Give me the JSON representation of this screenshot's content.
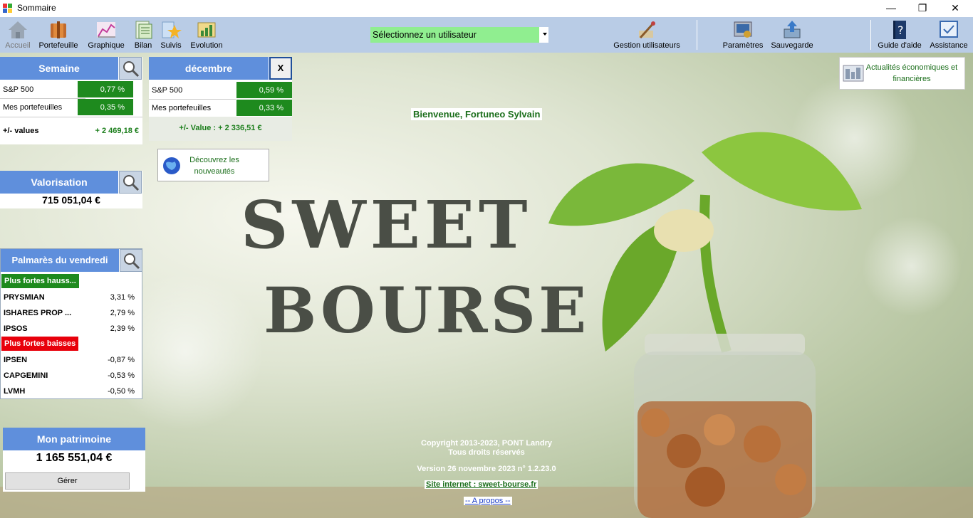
{
  "window": {
    "title": "Sommaire",
    "minimize": "—",
    "maximize": "❐",
    "close": "✕"
  },
  "toolbar": {
    "items": [
      {
        "label": "Accueil",
        "icon": "house-icon"
      },
      {
        "label": "Portefeuille",
        "icon": "portfolio-icon"
      },
      {
        "label": "Graphique",
        "icon": "chart-icon"
      },
      {
        "label": "Bilan",
        "icon": "report-icon"
      },
      {
        "label": "Suivis",
        "icon": "star-icon"
      },
      {
        "label": "Evolution",
        "icon": "evolution-icon"
      },
      {
        "label": "Gestion utilisateurs",
        "icon": "user-tools-icon"
      },
      {
        "label": "Paramètres",
        "icon": "settings-icon"
      },
      {
        "label": "Sauvegarde",
        "icon": "save-icon"
      },
      {
        "label": "Guide d'aide",
        "icon": "help-book-icon"
      },
      {
        "label": "Assistance",
        "icon": "assistance-icon"
      }
    ],
    "user_select": "Sélectionnez un utilisateur"
  },
  "semaine": {
    "title": "Semaine",
    "rows": [
      {
        "name": "S&P 500",
        "value": "0,77 %"
      },
      {
        "name": "Mes portefeuilles",
        "value": "0,35 %"
      }
    ],
    "pv_label": "+/- values",
    "pv_value": "+ 2 469,18 €"
  },
  "mois": {
    "title": "décembre",
    "close": "X",
    "rows": [
      {
        "name": "S&P 500",
        "value": "0,59 %"
      },
      {
        "name": "Mes portefeuilles",
        "value": "0,33 %"
      }
    ],
    "pv": "+/- Value : + 2 336,51 €"
  },
  "nouveautes": "Découvrez les nouveautés",
  "valorisation": {
    "title": "Valorisation",
    "value": "715 051,04 €"
  },
  "palmares": {
    "title": "Palmarès du vendredi",
    "hausses_label": "Plus fortes hauss...",
    "hausses": [
      {
        "name": "PRYSMIAN",
        "value": "3,31 %"
      },
      {
        "name": "ISHARES PROP ...",
        "value": "2,79 %"
      },
      {
        "name": "IPSOS",
        "value": "2,39 %"
      }
    ],
    "baisses_label": "Plus fortes baisses",
    "baisses": [
      {
        "name": "IPSEN",
        "value": "-0,87 %"
      },
      {
        "name": "CAPGEMINI",
        "value": "-0,53 %"
      },
      {
        "name": "LVMH",
        "value": "-0,50 %"
      }
    ]
  },
  "patrimoine": {
    "title": "Mon patrimoine",
    "value": "1 165 551,04 €",
    "button": "Gérer"
  },
  "actualites": "Actualités économiques et financières",
  "welcome": "Bienvenue, Fortuneo Sylvain",
  "logo": {
    "line1": "SWEET",
    "line2": "BOURSE"
  },
  "footer": {
    "copyright": "Copyright 2013-2023, PONT Landry",
    "rights": "Tous droits réservés",
    "version": "Version  26 novembre 2023 n° 1.2.23.0",
    "site": "Site internet : sweet-bourse.fr",
    "apropos": "-- A propos --"
  },
  "colors": {
    "header_blue": "#5f8fdc",
    "green": "#1e8a1e",
    "red": "#e8000b",
    "toolbar": "#b9cce6",
    "select_green": "#90ee90"
  }
}
